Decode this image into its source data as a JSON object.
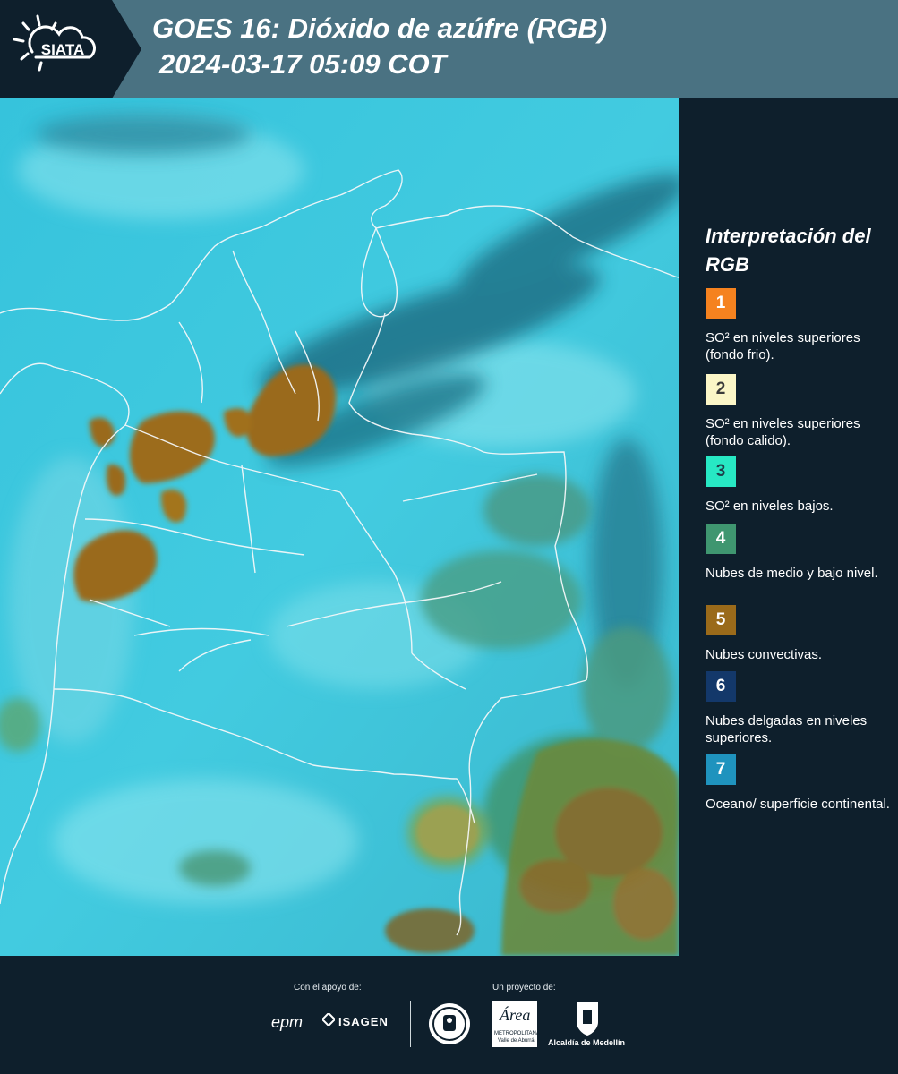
{
  "header": {
    "title_line1": "GOES 16: Dióxido de azúfre (RGB)",
    "title_line2": "2024-03-17 05:09 COT",
    "logo_text": "SIATA"
  },
  "legend": {
    "title": "Interpretación del RGB",
    "items": [
      {
        "number": "1",
        "color": "#f5821f",
        "text_color": "#ffffff",
        "label": "SO² en niveles superiores (fondo frio)."
      },
      {
        "number": "2",
        "color": "#fbf6c7",
        "text_color": "#3a3a3a",
        "label": "SO² en niveles superiores (fondo calido)."
      },
      {
        "number": "3",
        "color": "#27e8c4",
        "text_color": "#1f3f4a",
        "label": "SO² en niveles bajos."
      },
      {
        "number": "4",
        "color": "#3f9670",
        "text_color": "#ffffff",
        "label": "Nubes de medio y bajo nivel."
      },
      {
        "number": "5",
        "color": "#9a6a1a",
        "text_color": "#ffffff",
        "label": "Nubes convectivas."
      },
      {
        "number": "6",
        "color": "#13386a",
        "text_color": "#ffffff",
        "label": "Nubes delgadas en niveles superiores."
      },
      {
        "number": "7",
        "color": "#1f93be",
        "text_color": "#ffffff",
        "label": "Oceano/ superficie continental."
      }
    ]
  },
  "footer": {
    "support_label": "Con el apoyo de:",
    "project_label": "Un proyecto de:",
    "sponsors": [
      "epm",
      "ISAGEN"
    ],
    "partners": [
      "Área Metropolitana Valle de Aburrá",
      "Alcaldía de Medellín"
    ],
    "alcaldia_caption": "Alcaldía de Medellín",
    "area_word": "Área",
    "area_sub1": "METROPOLITANA",
    "area_sub2": "Valle de Aburrá"
  },
  "colors": {
    "header_bg": "#4a7282",
    "panel_bg": "#0e1f2c",
    "map_base": "#38c6dc",
    "convective": "#9a6a1a",
    "low_clouds": "#3f9670"
  }
}
